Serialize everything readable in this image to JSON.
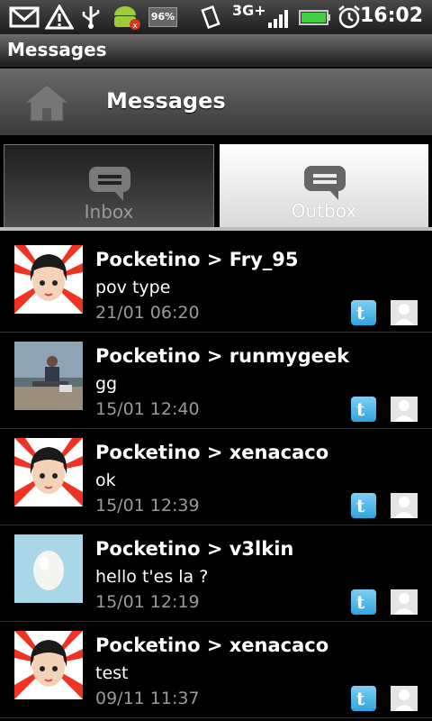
{
  "status_bar": {
    "time": "16:02",
    "network": "3G+",
    "battery_badge": "96%",
    "icons": [
      "gmail-icon",
      "warning-icon",
      "usb-icon",
      "android-debug-icon",
      "battery-percent-icon",
      "vibrate-icon",
      "signal-icon",
      "battery-icon",
      "alarm-icon"
    ]
  },
  "app_bar": {
    "title": "Messages"
  },
  "header": {
    "title": "Messages",
    "home_icon": "home-icon"
  },
  "tabs": [
    {
      "label": "Inbox",
      "icon": "speech-bubble-icon",
      "selected": false
    },
    {
      "label": "Outbox",
      "icon": "speech-bubble-icon",
      "selected": true
    }
  ],
  "messages": [
    {
      "title": "Pocketino > Fry_95",
      "text": "pov type",
      "date": "21/01 06:20",
      "avatar": "anime-girl-avatar"
    },
    {
      "title": "Pocketino > runmygeek",
      "text": "gg",
      "date": "15/01 12:40",
      "avatar": "photo-avatar"
    },
    {
      "title": "Pocketino > xenacaco",
      "text": "ok",
      "date": "15/01 12:39",
      "avatar": "anime-girl-avatar"
    },
    {
      "title": "Pocketino > v3lkin",
      "text": "hello t'es la ?",
      "date": "15/01 12:19",
      "avatar": "egg-avatar"
    },
    {
      "title": "Pocketino > xenacaco",
      "text": "test",
      "date": "09/11 11:37",
      "avatar": "anime-girl-avatar"
    }
  ]
}
